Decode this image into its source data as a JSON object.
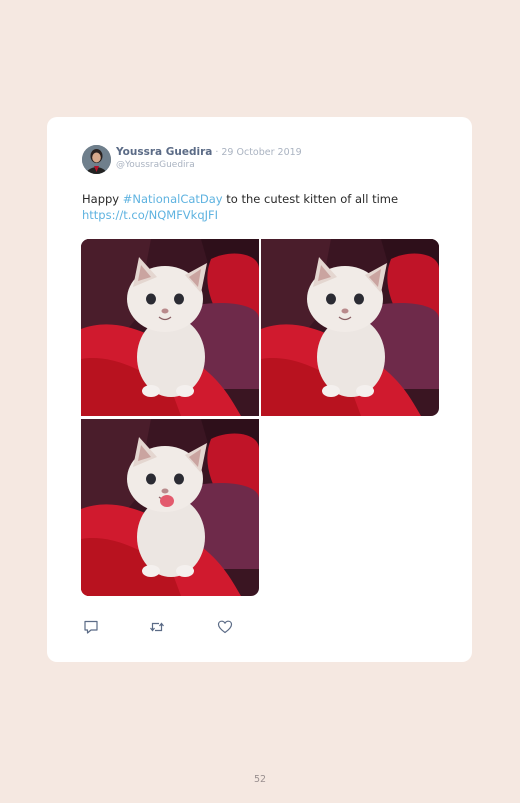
{
  "tweet": {
    "author_name": "Youssra Guedira",
    "date": "· 29 October 2019",
    "handle": "@YoussraGuedira",
    "text_before": "Happy ",
    "hashtag": "#NationalCatDay",
    "text_after": " to the cutest kitten of all time",
    "link": "https://t.co/NQMFVkqJFI",
    "photos": [
      "kitten-photo-1",
      "kitten-photo-2",
      "kitten-photo-3"
    ],
    "actions": [
      "reply-icon",
      "retweet-icon",
      "like-icon"
    ]
  },
  "page": {
    "number": "52"
  },
  "colors": {
    "background": "#f5e8e1",
    "card": "#ffffff",
    "name": "#5b6b86",
    "muted": "#aab3c1",
    "link": "#5fb3e0"
  }
}
